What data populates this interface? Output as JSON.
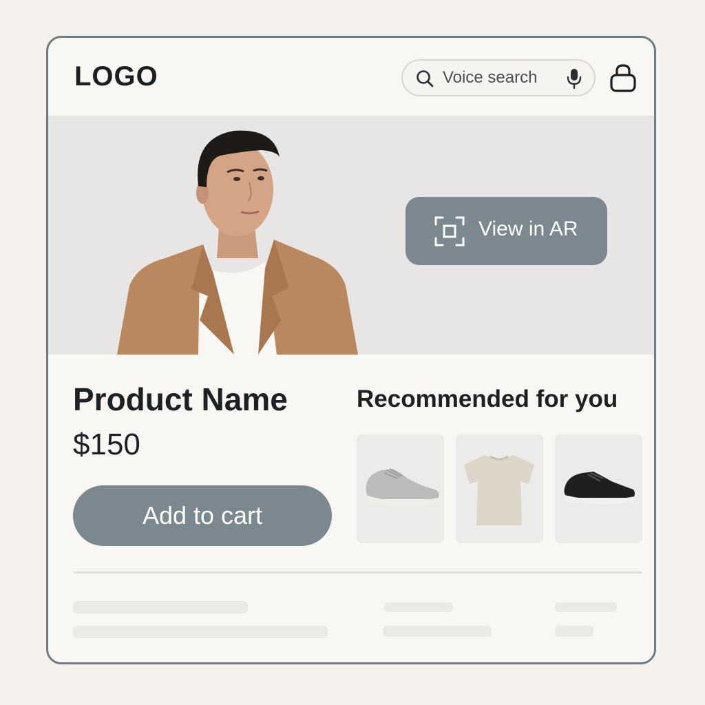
{
  "header": {
    "logo_text": "LOGO",
    "search": {
      "placeholder": "Voice search",
      "value": "",
      "icon": "search-icon",
      "voice_icon": "microphone-icon"
    },
    "cart_icon": "shopping-bag-icon"
  },
  "hero": {
    "ar_button_label": "View in AR",
    "ar_icon": "ar-scan-icon",
    "image": "man-in-camel-coat-photo"
  },
  "product": {
    "name": "Product Name",
    "price": "$150",
    "add_to_cart_label": "Add to cart"
  },
  "recommended": {
    "title": "Recommended for you",
    "items": [
      {
        "name": "sneaker-gray",
        "icon": "gray-sneaker-image"
      },
      {
        "name": "t-shirt-beige",
        "icon": "beige-tshirt-image"
      },
      {
        "name": "sneaker-black",
        "icon": "black-sneaker-image"
      }
    ]
  },
  "colors": {
    "accent": "#7b8890",
    "frame_border": "#6f7b82",
    "background": "#f5f2ed",
    "card_background": "#f9f7f3",
    "hero_background": "#e7e6e4"
  }
}
